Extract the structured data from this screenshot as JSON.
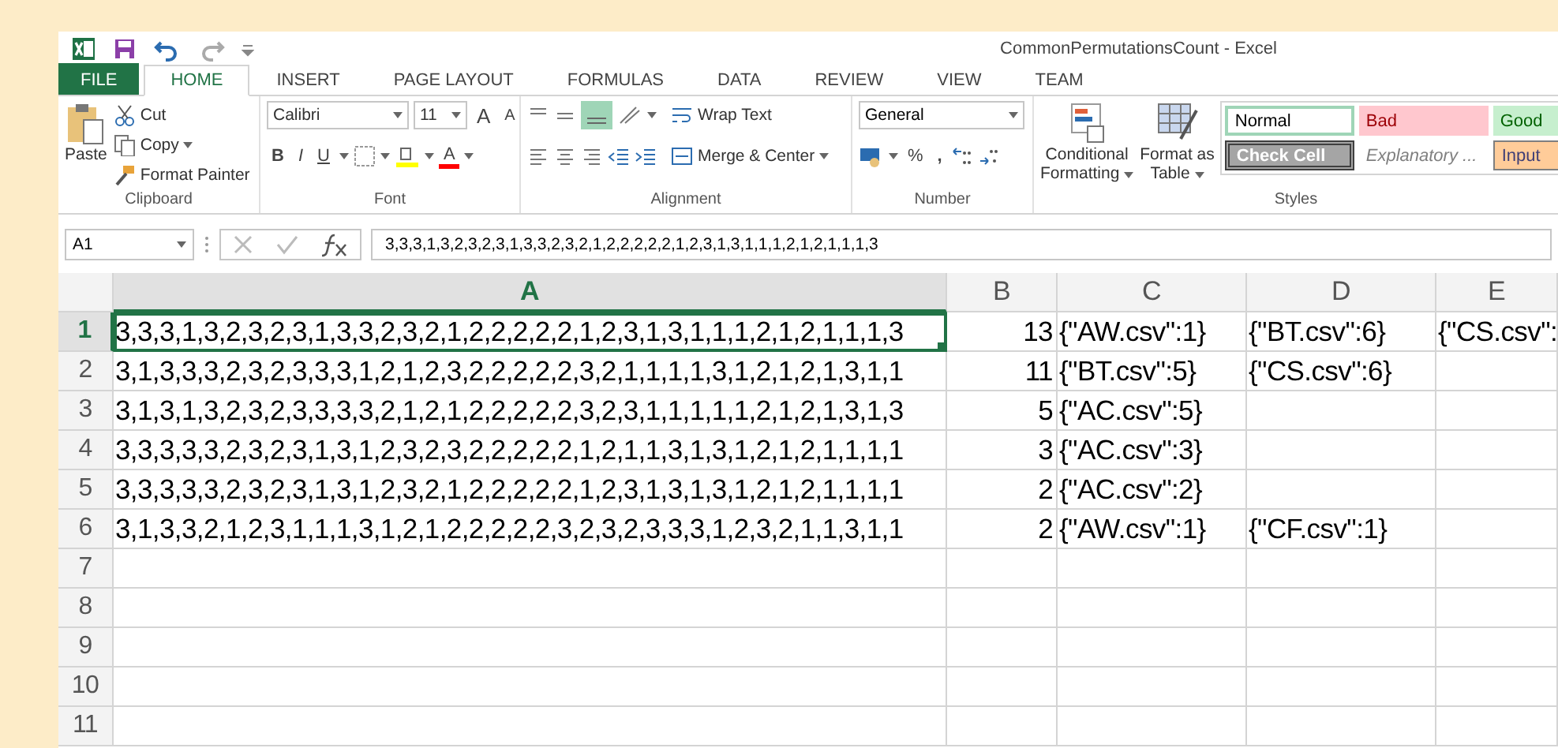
{
  "window": {
    "title": "CommonPermutationsCount - Excel"
  },
  "tabs": [
    {
      "label": "FILE",
      "kind": "file",
      "selected": false
    },
    {
      "label": "HOME",
      "kind": "tab",
      "selected": true
    },
    {
      "label": "INSERT",
      "kind": "tab",
      "selected": false
    },
    {
      "label": "PAGE LAYOUT",
      "kind": "tab",
      "selected": false
    },
    {
      "label": "FORMULAS",
      "kind": "tab",
      "selected": false
    },
    {
      "label": "DATA",
      "kind": "tab",
      "selected": false
    },
    {
      "label": "REVIEW",
      "kind": "tab",
      "selected": false
    },
    {
      "label": "VIEW",
      "kind": "tab",
      "selected": false
    },
    {
      "label": "TEAM",
      "kind": "tab",
      "selected": false
    }
  ],
  "ribbon": {
    "clipboard": {
      "label": "Clipboard",
      "paste": "Paste",
      "cut": "Cut",
      "copy": "Copy",
      "format_painter": "Format Painter"
    },
    "font": {
      "label": "Font",
      "font_name": "Calibri",
      "font_size": "11",
      "grow": "A",
      "shrink": "A",
      "bold": "B",
      "italic": "I",
      "underline": "U",
      "font_color_letter": "A"
    },
    "alignment": {
      "label": "Alignment",
      "wrap_text": "Wrap Text",
      "merge_center": "Merge & Center"
    },
    "number": {
      "label": "Number",
      "format": "General",
      "percent": "%",
      "comma": ","
    },
    "styles": {
      "label": "Styles",
      "conditional_formatting": [
        "Conditional",
        "Formatting"
      ],
      "format_as_table": [
        "Format as",
        "Table"
      ],
      "cells": [
        {
          "label": "Normal",
          "kind": "normal"
        },
        {
          "label": "Bad",
          "kind": "bad"
        },
        {
          "label": "Good",
          "kind": "good"
        },
        {
          "label": "Check Cell",
          "kind": "check"
        },
        {
          "label": "Explanatory ...",
          "kind": "explanatory"
        },
        {
          "label": "Input",
          "kind": "input"
        }
      ]
    }
  },
  "formula_bar": {
    "name_box": "A1",
    "formula": "3,3,3,1,3,2,3,2,3,1,3,3,2,3,2,1,2,2,2,2,2,1,2,3,1,3,1,1,1,2,1,2,1,1,1,3"
  },
  "sheet": {
    "columns": [
      {
        "label": "A",
        "selected": true
      },
      {
        "label": "B",
        "selected": false
      },
      {
        "label": "C",
        "selected": false
      },
      {
        "label": "D",
        "selected": false
      },
      {
        "label": "E",
        "selected": false
      }
    ],
    "rows": [
      {
        "label": "1",
        "selected": true,
        "cells": {
          "A": "3,3,3,1,3,2,3,2,3,1,3,3,2,3,2,1,2,2,2,2,2,1,2,3,1,3,1,1,1,2,1,2,1,1,1,3",
          "B": "13",
          "C": "{\"AW.csv\":1}",
          "D": "{\"BT.csv\":6}",
          "E": "{\"CS.csv\":"
        }
      },
      {
        "label": "2",
        "selected": false,
        "cells": {
          "A": "3,1,3,3,3,2,3,2,3,3,3,1,2,1,2,3,2,2,2,2,2,3,2,1,1,1,1,3,1,2,1,2,1,3,1,1",
          "B": "11",
          "C": "{\"BT.csv\":5}",
          "D": "{\"CS.csv\":6}"
        }
      },
      {
        "label": "3",
        "selected": false,
        "cells": {
          "A": "3,1,3,1,3,2,3,2,3,3,3,3,2,1,2,1,2,2,2,2,2,3,2,3,1,1,1,1,1,2,1,2,1,3,1,3",
          "B": "5",
          "C": "{\"AC.csv\":5}"
        }
      },
      {
        "label": "4",
        "selected": false,
        "cells": {
          "A": "3,3,3,3,3,2,3,2,3,1,3,1,2,3,2,3,2,2,2,2,2,1,2,1,1,3,1,3,1,2,1,2,1,1,1,1",
          "B": "3",
          "C": "{\"AC.csv\":3}"
        }
      },
      {
        "label": "5",
        "selected": false,
        "cells": {
          "A": "3,3,3,3,3,2,3,2,3,1,3,1,2,3,2,1,2,2,2,2,2,1,2,3,1,3,1,3,1,2,1,2,1,1,1,1",
          "B": "2",
          "C": "{\"AC.csv\":2}"
        }
      },
      {
        "label": "6",
        "selected": false,
        "cells": {
          "A": "3,1,3,3,2,1,2,3,1,1,1,3,1,2,1,2,2,2,2,2,3,2,3,2,3,3,3,1,2,3,2,1,1,3,1,1",
          "B": "2",
          "C": "{\"AW.csv\":1}",
          "D": "{\"CF.csv\":1}"
        }
      },
      {
        "label": "7",
        "selected": false
      },
      {
        "label": "8",
        "selected": false
      },
      {
        "label": "9",
        "selected": false
      },
      {
        "label": "10",
        "selected": false
      },
      {
        "label": "11",
        "selected": false
      }
    ]
  }
}
